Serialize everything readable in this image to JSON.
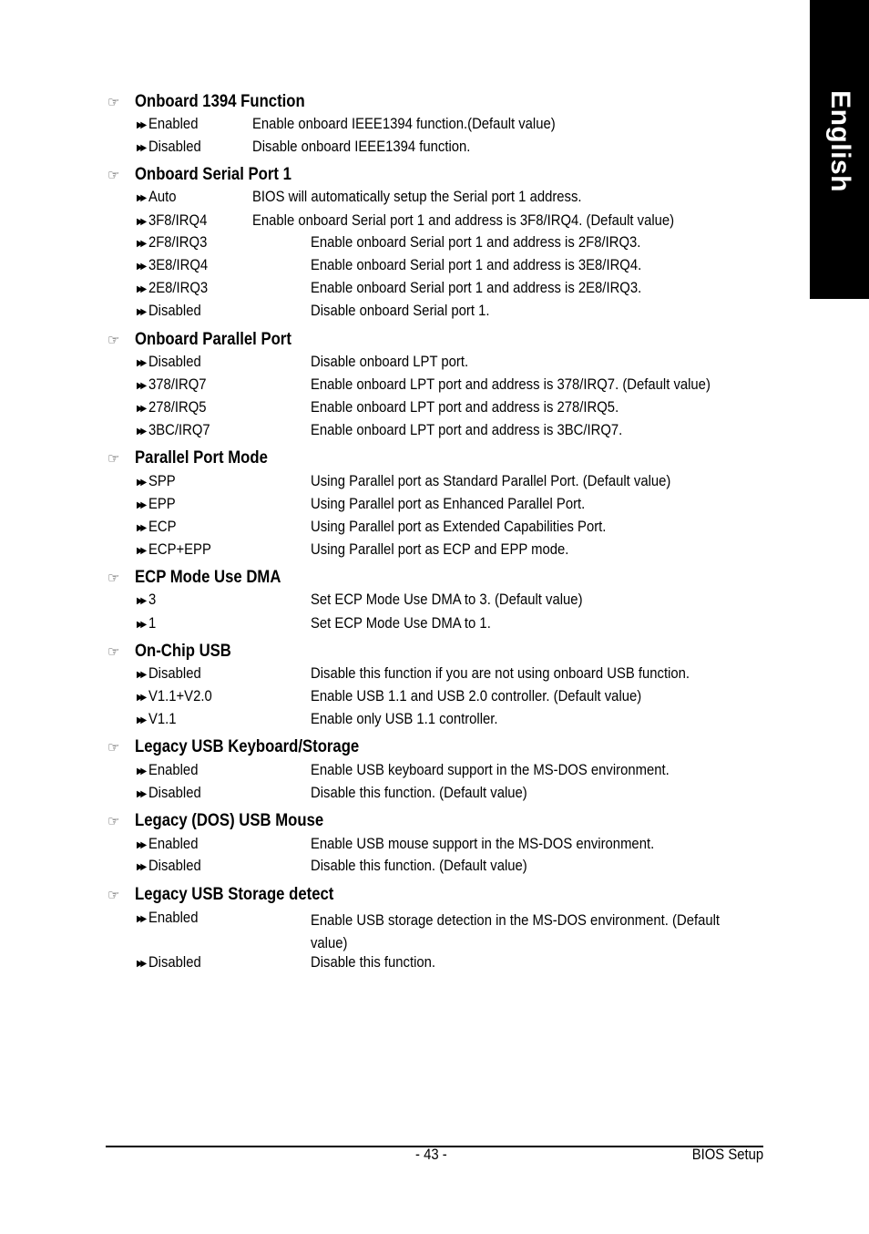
{
  "side_tab": {
    "label": "English"
  },
  "sections": [
    {
      "title": "Onboard 1394 Function",
      "options": [
        {
          "key": "Enabled",
          "desc": "Enable onboard IEEE1394 function.(Default value)"
        },
        {
          "key": "Disabled",
          "desc": "Disable onboard IEEE1394 function."
        }
      ]
    },
    {
      "title": "Onboard Serial Port 1",
      "options": [
        {
          "key": "Auto",
          "desc": "BIOS will automatically setup the Serial port 1 address."
        },
        {
          "key": "3F8/IRQ4",
          "desc": "Enable onboard Serial port 1 and address is 3F8/IRQ4. (Default value)"
        },
        {
          "key": "2F8/IRQ3",
          "desc": "Enable onboard Serial port 1 and address is 2F8/IRQ3."
        },
        {
          "key": "3E8/IRQ4",
          "desc": "Enable onboard Serial port 1 and address is 3E8/IRQ4."
        },
        {
          "key": "2E8/IRQ3",
          "desc": "Enable onboard Serial port 1 and address is 2E8/IRQ3."
        },
        {
          "key": "Disabled",
          "desc": "Disable onboard Serial port 1."
        }
      ]
    },
    {
      "title": "Onboard Parallel Port",
      "options": [
        {
          "key": "Disabled",
          "desc": "Disable onboard LPT port."
        },
        {
          "key": "378/IRQ7",
          "desc": "Enable onboard LPT port and address is 378/IRQ7. (Default value)"
        },
        {
          "key": "278/IRQ5",
          "desc": "Enable onboard LPT port and address is 278/IRQ5."
        },
        {
          "key": "3BC/IRQ7",
          "desc": "Enable onboard LPT port and address is 3BC/IRQ7."
        }
      ]
    },
    {
      "title": "Parallel Port Mode",
      "options": [
        {
          "key": "SPP",
          "desc": "Using Parallel port as Standard Parallel Port. (Default value)"
        },
        {
          "key": "EPP",
          "desc": "Using Parallel port as Enhanced Parallel Port."
        },
        {
          "key": "ECP",
          "desc": "Using Parallel port as Extended Capabilities Port."
        },
        {
          "key": "ECP+EPP",
          "desc": "Using Parallel port as ECP and EPP mode."
        }
      ]
    },
    {
      "title": "ECP Mode Use DMA",
      "options": [
        {
          "key": "3",
          "desc": "Set ECP Mode Use DMA to 3. (Default value)"
        },
        {
          "key": "1",
          "desc": "Set ECP Mode Use DMA to 1."
        }
      ]
    },
    {
      "title": "On-Chip USB",
      "options": [
        {
          "key": "Disabled",
          "desc": "Disable this function if you are not using onboard USB function."
        },
        {
          "key": "V1.1+V2.0",
          "desc": "Enable USB 1.1 and USB 2.0 controller. (Default value)"
        },
        {
          "key": "V1.1",
          "desc": "Enable only USB 1.1 controller."
        }
      ]
    },
    {
      "title": "Legacy USB Keyboard/Storage",
      "options": [
        {
          "key": "Enabled",
          "desc": "Enable USB keyboard support in the MS-DOS environment."
        },
        {
          "key": "Disabled",
          "desc": "Disable this function. (Default value)"
        }
      ]
    },
    {
      "title": "Legacy (DOS) USB Mouse",
      "options": [
        {
          "key": "Enabled",
          "desc": "Enable USB mouse support in the MS-DOS environment."
        },
        {
          "key": "Disabled",
          "desc": "Disable this function. (Default value)"
        }
      ]
    },
    {
      "title": "Legacy USB Storage detect",
      "options": [
        {
          "key": "Enabled",
          "desc": "Enable USB storage detection in the MS-DOS environment. (Default",
          "desc_line2": "value)"
        },
        {
          "key": "Disabled",
          "desc": "Disable this function."
        }
      ]
    }
  ],
  "footer": {
    "page_number": "- 43 -",
    "section_title": "BIOS Setup"
  }
}
